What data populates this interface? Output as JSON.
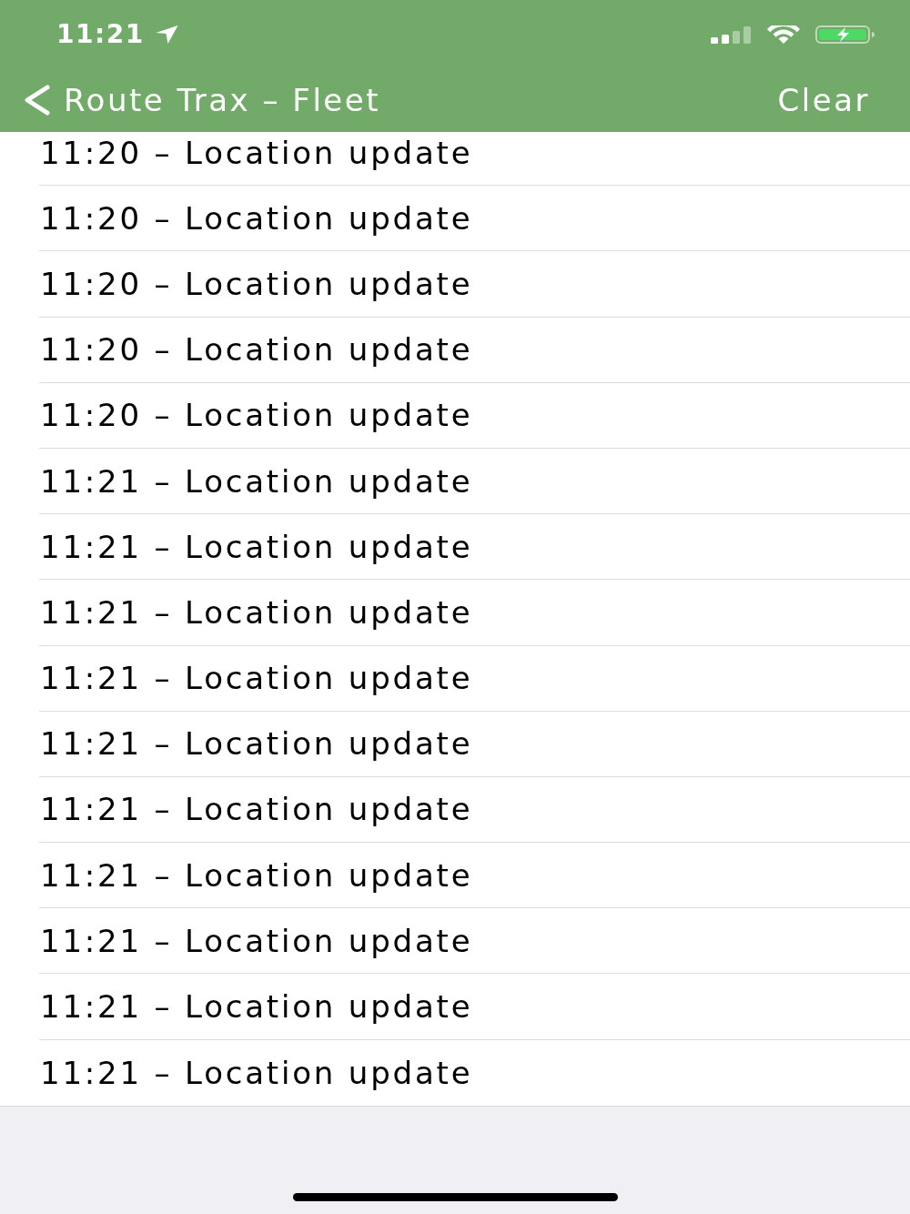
{
  "status_bar": {
    "time": "11:21"
  },
  "nav_bar": {
    "back_label": "Route Trax – Fleet",
    "action": "Clear"
  },
  "log_entries": [
    "11:20 – Location update",
    "11:20 – Location update",
    "11:20 – Location update",
    "11:20 – Location update",
    "11:20 – Location update",
    "11:21 – Location update",
    "11:21 – Location update",
    "11:21 – Location update",
    "11:21 – Location update",
    "11:21 – Location update",
    "11:21 – Location update",
    "11:21 – Location update",
    "11:21 – Location update",
    "11:21 – Location update",
    "11:21 – Location update"
  ]
}
